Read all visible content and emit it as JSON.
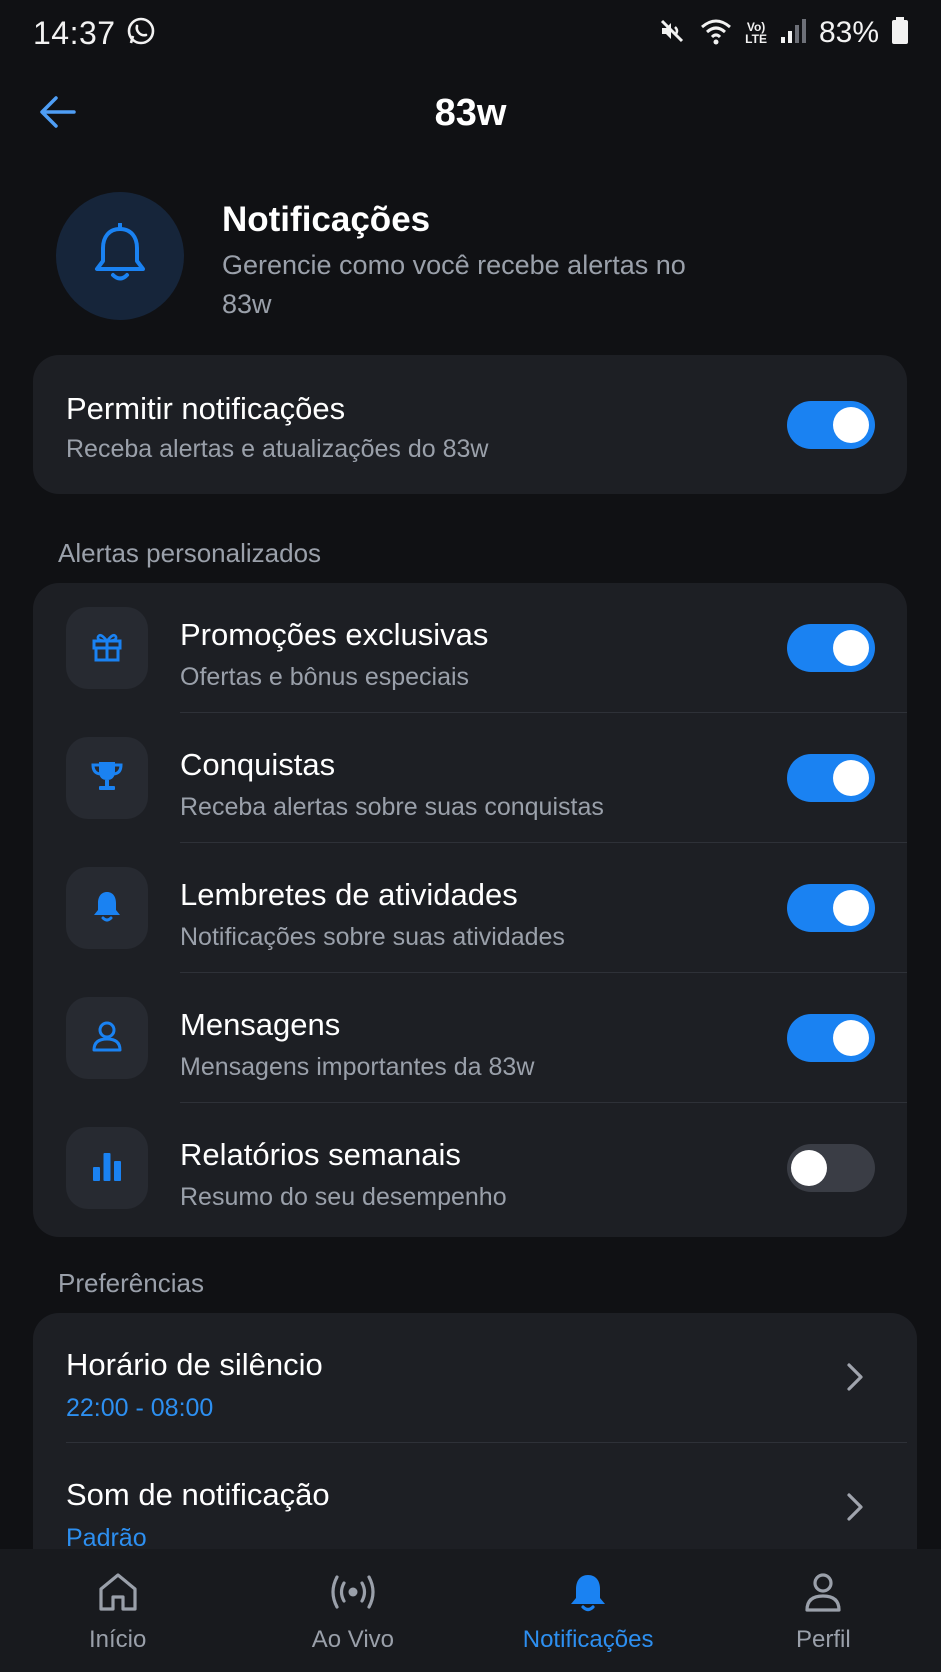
{
  "status_bar": {
    "time": "14:37",
    "network": "Vo)\nLTE",
    "battery": "83%",
    "icons": [
      "whatsapp-icon",
      "mute-icon",
      "wifi-icon",
      "volte-icon",
      "signal-icon",
      "battery-icon"
    ]
  },
  "app_bar": {
    "title": "83w",
    "back_icon": "arrow-left-icon"
  },
  "header": {
    "icon": "bell-icon",
    "title": "Notificações",
    "subtitle": "Gerencie como você recebe alertas no 83w"
  },
  "allow": {
    "title": "Permitir notificações",
    "subtitle": "Receba alertas e atualizações do 83w",
    "enabled": true
  },
  "alerts": {
    "section_label": "Alertas personalizados",
    "items": [
      {
        "icon": "gift-icon",
        "title": "Promoções exclusivas",
        "subtitle": "Ofertas e bônus especiais",
        "enabled": true
      },
      {
        "icon": "trophy-icon",
        "title": "Conquistas",
        "subtitle": "Receba alertas sobre suas conquistas",
        "enabled": true
      },
      {
        "icon": "bell-icon",
        "title": "Lembretes de atividades",
        "subtitle": "Notificações sobre suas atividades",
        "enabled": true
      },
      {
        "icon": "user-icon",
        "title": "Mensagens",
        "subtitle": "Mensagens importantes da 83w",
        "enabled": true
      },
      {
        "icon": "bar-chart-icon",
        "title": "Relatórios semanais",
        "subtitle": "Resumo do seu desempenho",
        "enabled": false
      }
    ]
  },
  "preferences": {
    "section_label": "Preferências",
    "items": [
      {
        "title": "Horário de silêncio",
        "value": "22:00 - 08:00",
        "icon": "chevron-right-icon"
      },
      {
        "title": "Som de notificação",
        "value": "Padrão",
        "icon": "chevron-right-icon"
      }
    ]
  },
  "bottom_nav": {
    "items": [
      {
        "label": "Início",
        "icon": "home-icon",
        "active": false
      },
      {
        "label": "Ao Vivo",
        "icon": "broadcast-icon",
        "active": false
      },
      {
        "label": "Notificações",
        "icon": "bell-icon",
        "active": true
      },
      {
        "label": "Perfil",
        "icon": "user-icon",
        "active": false
      }
    ]
  },
  "colors": {
    "background": "#101114",
    "card": "#1d1f24",
    "accent": "#1a82f2",
    "muted_text": "#9aa0aa",
    "toggle_off": "#3a3d45"
  }
}
